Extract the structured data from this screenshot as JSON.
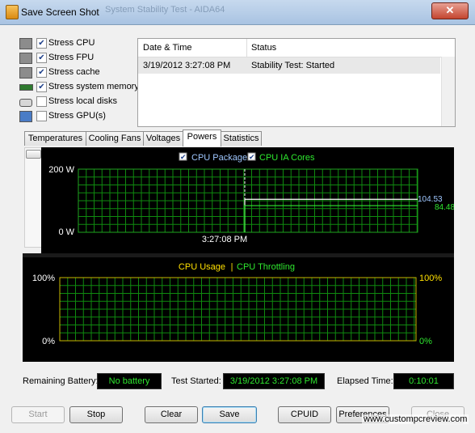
{
  "window": {
    "title": "Save Screen Shot",
    "ghost_title": "System Stability Test - AIDA64",
    "close_glyph": "✕"
  },
  "stress": [
    {
      "label": "Stress CPU",
      "checked": true,
      "icon": "cpu-chip-icon"
    },
    {
      "label": "Stress FPU",
      "checked": true,
      "icon": "fpu-chip-icon"
    },
    {
      "label": "Stress cache",
      "checked": true,
      "icon": "cache-chip-icon"
    },
    {
      "label": "Stress system memory",
      "checked": true,
      "icon": "memory-module-icon"
    },
    {
      "label": "Stress local disks",
      "checked": false,
      "icon": "disk-drive-icon"
    },
    {
      "label": "Stress GPU(s)",
      "checked": false,
      "icon": "gpu-monitor-icon"
    }
  ],
  "status_table": {
    "headers": [
      "Date & Time",
      "Status"
    ],
    "rows": [
      {
        "datetime": "3/19/2012 3:27:08 PM",
        "status": "Stability Test: Started"
      }
    ]
  },
  "tabs": [
    "Temperatures",
    "Cooling Fans",
    "Voltages",
    "Powers",
    "Statistics"
  ],
  "active_tab": "Powers",
  "chart_data": [
    {
      "type": "line",
      "legend": [
        "CPU Package",
        "CPU IA Cores"
      ],
      "legend_checked": [
        true,
        true
      ],
      "ylim": [
        0,
        200
      ],
      "y_tick_labels": [
        "200 W",
        "0 W"
      ],
      "marker_label": "3:27:08 PM",
      "series": [
        {
          "name": "CPU Package",
          "color": "#ffffff",
          "last_value": 104.53,
          "last_label": "104.53"
        },
        {
          "name": "CPU IA Cores",
          "color": "#2fe82f",
          "last_value": 84.48,
          "last_label": "84.48"
        }
      ]
    },
    {
      "type": "line",
      "legend": [
        "CPU Usage",
        "CPU Throttling"
      ],
      "legend_separator": "|",
      "ylim": [
        0,
        100
      ],
      "y_tick_labels_left": [
        "100%",
        "0%"
      ],
      "y_tick_labels_right": [
        "100%",
        "0%"
      ],
      "series": [
        {
          "name": "CPU Usage",
          "color": "#ffe000"
        },
        {
          "name": "CPU Throttling",
          "color": "#2fe82f"
        }
      ]
    }
  ],
  "colors": {
    "grid": "#0f8a0f",
    "accent_green": "#2fe82f",
    "accent_yellow": "#ffe000",
    "package_blue": "#9fc7ff"
  },
  "bottom": {
    "remaining_battery_label": "Remaining Battery:",
    "remaining_battery_value": "No battery",
    "test_started_label": "Test Started:",
    "test_started_value": "3/19/2012 3:27:08 PM",
    "elapsed_label": "Elapsed Time:",
    "elapsed_value": "0:10:01"
  },
  "buttons": {
    "start": "Start",
    "stop": "Stop",
    "clear": "Clear",
    "save": "Save",
    "cpuid": "CPUID",
    "preferences": "Preferences",
    "close": "Close"
  },
  "watermark": "www.custompcreview.com"
}
